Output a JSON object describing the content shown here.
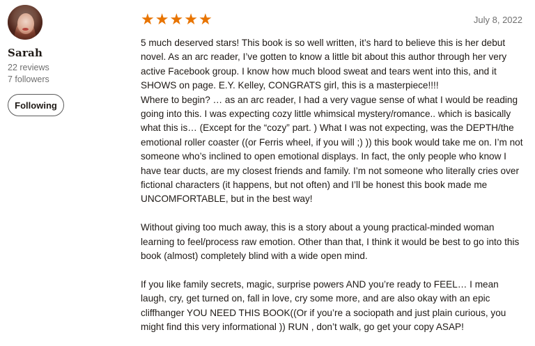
{
  "reviewer": {
    "name": "Sarah",
    "reviews": "22 reviews",
    "followers": "7 followers",
    "follow_button": "Following",
    "avatar_icon": "user-avatar-photo"
  },
  "review": {
    "rating": 5,
    "star_symbol": "★",
    "star_color": "#e87400",
    "date": "July 8, 2022",
    "paragraphs": [
      "5 much deserved stars! This book is so well written, it’s hard to believe this is her debut novel. As an arc reader, I’ve gotten to know a little bit about this author through her very active Facebook group. I know how much blood sweat and tears went into this, and it SHOWS on page. E.Y. Kelley, CONGRATS girl, this is a masterpiece!!!!",
      "Where to begin? … as an arc reader, I had a very vague sense of what I would be reading going into this. I was expecting cozy little whimsical mystery/romance.. which is basically what this is… (Except for the “cozy” part. ) What I was not expecting, was the DEPTH/the emotional roller coaster ((or Ferris wheel, if you will ;) )) this book would take me on. I’m not someone who’s inclined to open emotional displays. In fact, the only people who know I have tear ducts, are my closest friends and family. I’m not someone who literally cries over fictional characters (it happens, but not often) and I’ll be honest this book made me UNCOMFORTABLE, but in the best way!",
      "Without giving too much away, this is a story about a young practical-minded woman learning to feel/process raw emotion. Other than that, I think it would be best to go into this book (almost) completely blind with a wide open mind.",
      "If you like family secrets, magic, surprise powers AND you’re ready to FEEL… I mean laugh, cry, get turned on, fall in love, cry some more, and are also okay with an epic cliffhanger YOU NEED THIS BOOK((Or if you’re a sociopath and just plain curious, you might find this very informational )) RUN , don’t walk, go get your copy ASAP!"
    ]
  }
}
